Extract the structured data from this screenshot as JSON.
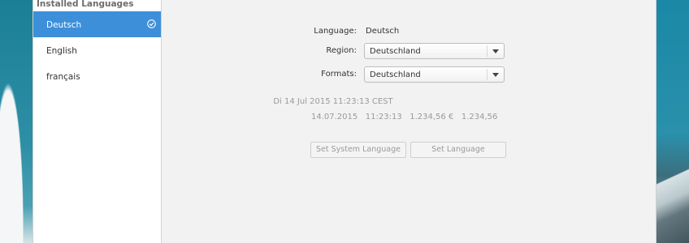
{
  "sidebar": {
    "header": "Installed Languages",
    "items": [
      {
        "label": "Deutsch",
        "selected": true
      },
      {
        "label": "English",
        "selected": false
      },
      {
        "label": "français",
        "selected": false
      }
    ]
  },
  "settings": {
    "language_label": "Language:",
    "language_value": "Deutsch",
    "region_label": "Region:",
    "region_value": "Deutschland",
    "formats_label": "Formats:",
    "formats_value": "Deutschland"
  },
  "preview": {
    "date": "Di 14 Jul 2015 11:23:13 CEST",
    "formats": "14.07.2015   11:23:13   1.234,56 €   1.234,56"
  },
  "buttons": {
    "set_system_language": "Set System Language",
    "set_language": "Set Language"
  },
  "colors": {
    "selection": "#3d8fd9",
    "disabled_text": "#9a9a9a"
  }
}
